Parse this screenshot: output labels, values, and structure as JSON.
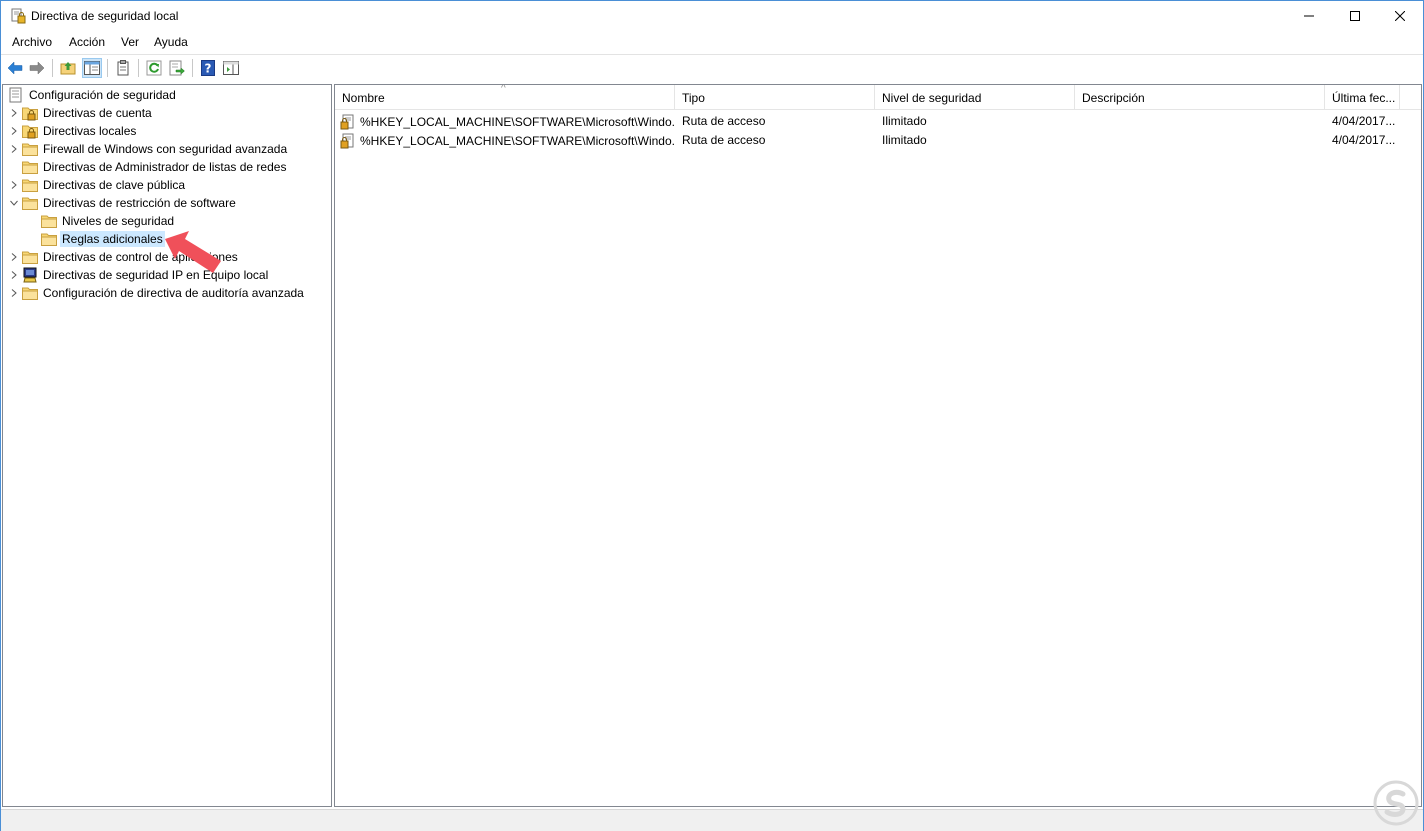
{
  "window": {
    "title": "Directiva de seguridad local"
  },
  "menu": [
    "Archivo",
    "Acción",
    "Ver",
    "Ayuda"
  ],
  "toolbar": {
    "buttons": [
      "back-icon",
      "forward-icon",
      "up-folder-icon",
      "show-hide-tree-icon",
      "properties-icon",
      "refresh-icon",
      "export-list-icon",
      "help-icon",
      "show-hide-action-pane-icon"
    ]
  },
  "tree": {
    "root": "Configuración de seguridad",
    "items": [
      {
        "label": "Directivas de cuenta",
        "expandable": true
      },
      {
        "label": "Directivas locales",
        "expandable": true
      },
      {
        "label": "Firewall de Windows con seguridad avanzada",
        "expandable": true
      },
      {
        "label": "Directivas de Administrador de listas de redes",
        "expandable": false
      },
      {
        "label": "Directivas de clave pública",
        "expandable": true
      },
      {
        "label": "Directivas de restricción de software",
        "expandable": true,
        "expanded": true
      },
      {
        "label": "Niveles de seguridad",
        "child": true
      },
      {
        "label": "Reglas adicionales",
        "child": true,
        "selected": true
      },
      {
        "label": "Directivas de control de aplicaciones",
        "expandable": true
      },
      {
        "label": "Directivas de seguridad IP en Equipo local",
        "expandable": true
      },
      {
        "label": "Configuración de directiva de auditoría avanzada",
        "expandable": true
      }
    ]
  },
  "list": {
    "columns": [
      "Nombre",
      "Tipo",
      "Nivel de seguridad",
      "Descripción",
      "Última fec..."
    ],
    "rows": [
      [
        "%HKEY_LOCAL_MACHINE\\SOFTWARE\\Microsoft\\Windo...",
        "Ruta de acceso",
        "Ilimitado",
        "",
        "4/04/2017..."
      ],
      [
        "%HKEY_LOCAL_MACHINE\\SOFTWARE\\Microsoft\\Windo...",
        "Ruta de acceso",
        "Ilimitado",
        "",
        "4/04/2017..."
      ]
    ]
  },
  "colors": {
    "selection": "#cce8ff",
    "annotation_arrow": "#f0505a",
    "logo": "#d8d8d8"
  }
}
